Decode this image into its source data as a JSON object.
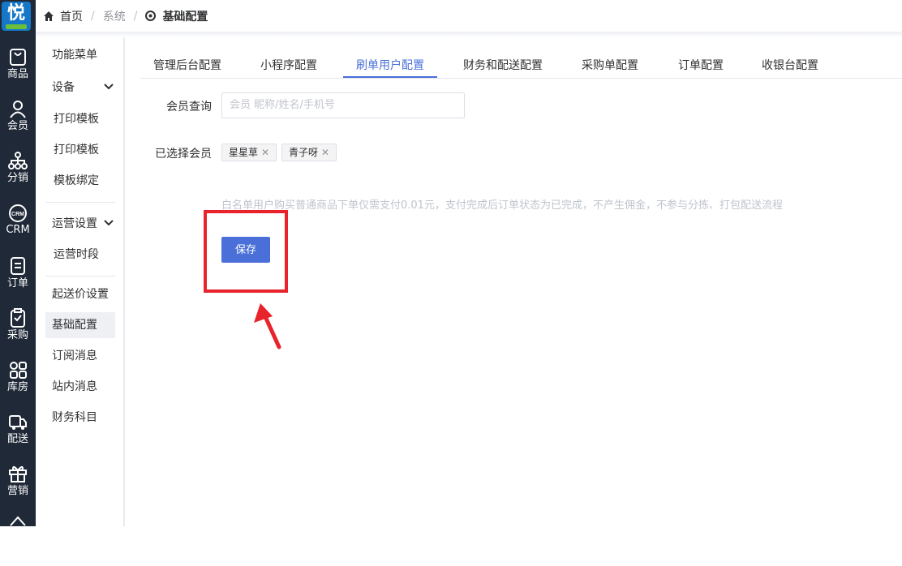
{
  "logo": {
    "text": "悦"
  },
  "rail": [
    {
      "label": "商品",
      "icon": "bag-icon"
    },
    {
      "label": "会员",
      "icon": "user-icon"
    },
    {
      "label": "分销",
      "icon": "org-icon"
    },
    {
      "label": "CRM",
      "icon": "crm-icon"
    },
    {
      "label": "订单",
      "icon": "doc-icon"
    },
    {
      "label": "采购",
      "icon": "clipboard-icon"
    },
    {
      "label": "库房",
      "icon": "grid-icon"
    },
    {
      "label": "配送",
      "icon": "truck-icon"
    },
    {
      "label": "营销",
      "icon": "gift-icon"
    }
  ],
  "breadcrumb": {
    "home": "首页",
    "middle": "系统",
    "current": "基础配置"
  },
  "sidebar": {
    "items": [
      "功能菜单",
      "设备",
      "打印模板",
      "打印模板",
      "模板绑定",
      "运营设置",
      "运营时段",
      "起送价设置",
      "基础配置",
      "订阅消息",
      "站内消息",
      "财务科目"
    ]
  },
  "tabs": [
    "管理后台配置",
    "小程序配置",
    "刷单用户配置",
    "财务和配送配置",
    "采购单配置",
    "订单配置",
    "收银台配置"
  ],
  "form": {
    "query_label": "会员查询",
    "query_placeholder": "会员 昵称/姓名/手机号",
    "selected_label": "已选择会员",
    "tags": [
      "星星草",
      "青子呀"
    ],
    "hint": "白名单用户购买普通商品下单仅需支付0.01元，支付完成后订单状态为已完成，不产生佣金，不参与分拣、打包配送流程",
    "save_label": "保存"
  },
  "colors": {
    "accent": "#4a6fd8",
    "rail": "#1f2937",
    "highlight": "#e8232b"
  }
}
